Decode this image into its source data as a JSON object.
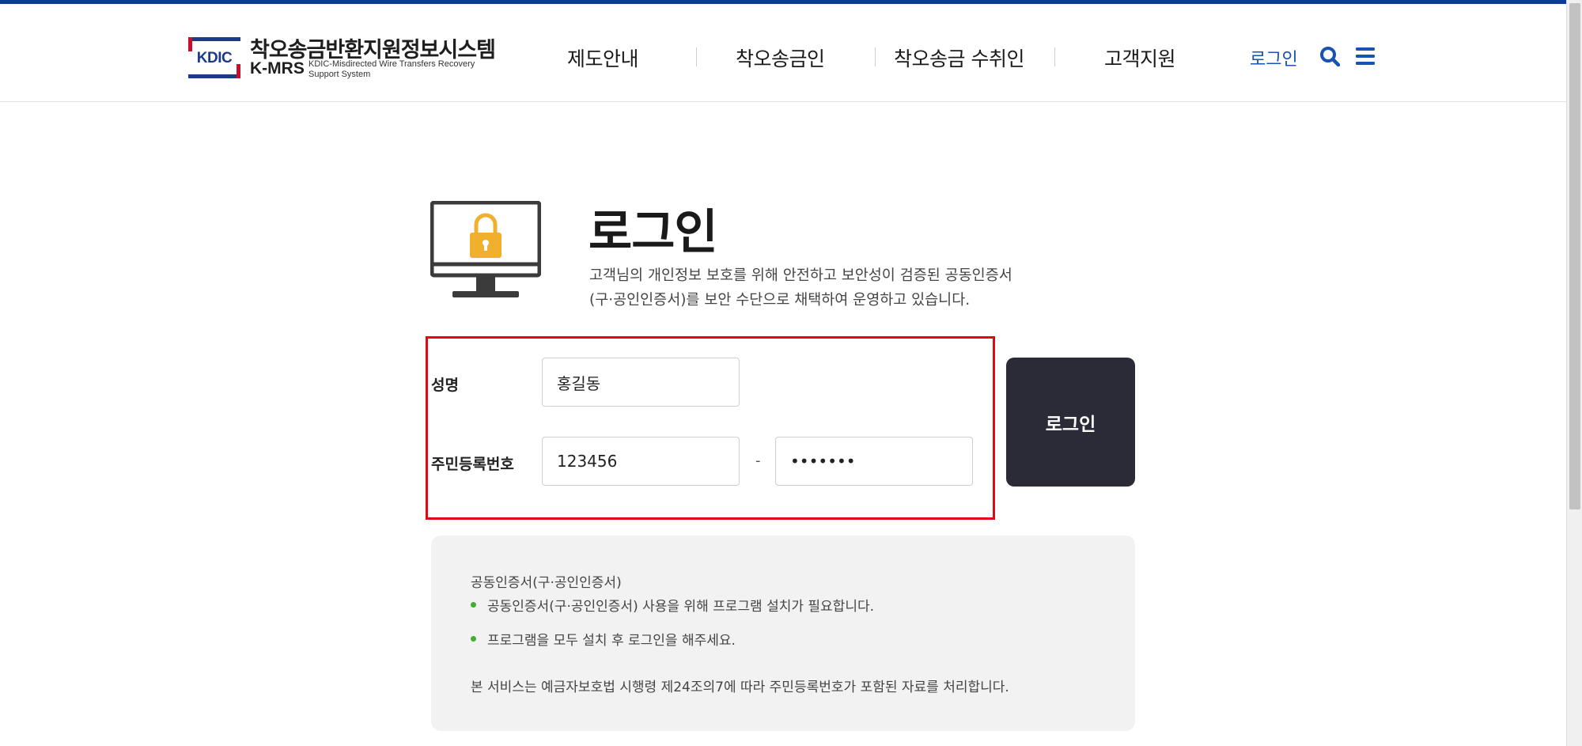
{
  "header": {
    "logo": {
      "box_text": "KDIC",
      "title": "착오송금반환지원정보시스템",
      "abbr": "K-MRS",
      "subtitle_line1": "KDIC-Misdirected Wire Transfers Recovery",
      "subtitle_line2": "Support System"
    },
    "nav": [
      {
        "label": "제도안내"
      },
      {
        "label": "착오송금인"
      },
      {
        "label": "착오송금 수취인"
      },
      {
        "label": "고객지원"
      }
    ],
    "login_link": "로그인",
    "icons": {
      "search": "search-icon",
      "menu": "menu-icon"
    },
    "accent_color": "#1853b4"
  },
  "main": {
    "icon": "monitor-lock-icon",
    "title": "로그인",
    "desc_line1": "고객님의 개인정보 보호를 위해 안전하고 보안성이 검증된 공동인증서",
    "desc_line2": "(구·공인인증서)를 보안 수단으로 채택하여 운영하고 있습니다."
  },
  "form": {
    "name_label": "성명",
    "name_value": "홍길동",
    "rrn_label": "주민등록번호",
    "rrn_front_value": "123456",
    "rrn_dash": "-",
    "rrn_back_value": "1234567",
    "submit_label": "로그인",
    "highlight_color": "#e30613"
  },
  "notice": {
    "title": "공동인증서(구·공인인증서)",
    "bullets": [
      "공동인증서(구·공인인증서) 사용을 위해 프로그램 설치가 필요합니다.",
      "프로그램을 모두 설치 후 로그인을 해주세요."
    ],
    "footer": "본 서비스는 예금자보호법 시행령 제24조의7에 따라 주민등록번호가 포함된 자료를 처리합니다."
  }
}
